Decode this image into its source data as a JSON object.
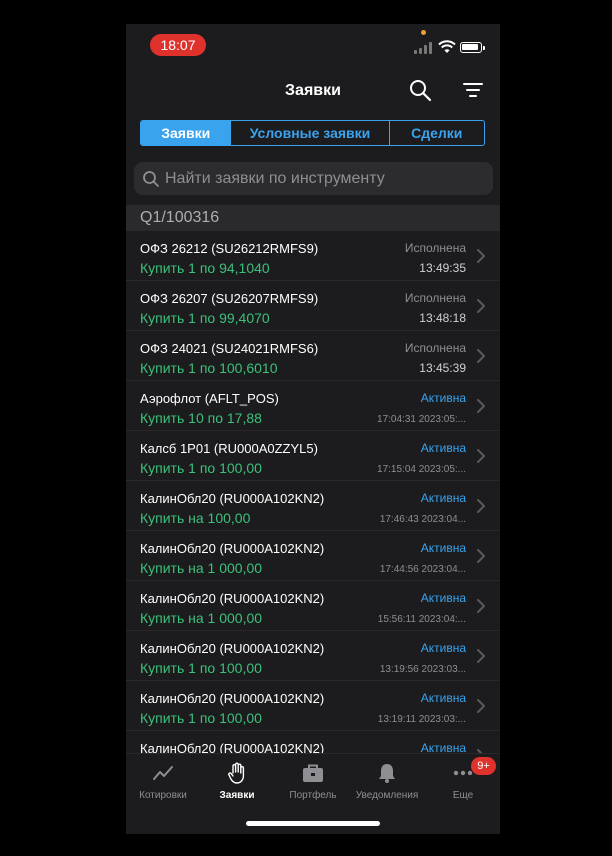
{
  "status_bar": {
    "time": "18:07"
  },
  "header": {
    "title": "Заявки"
  },
  "segments": [
    {
      "label": "Заявки",
      "active": true
    },
    {
      "label": "Условные заявки",
      "active": false
    },
    {
      "label": "Сделки",
      "active": false
    }
  ],
  "search": {
    "placeholder": "Найти заявки по инструменту"
  },
  "section": {
    "title": "Q1/100316"
  },
  "orders": [
    {
      "name": "ОФЗ 26212 (SU26212RMFS9)",
      "order": "Купить 1 по 94,1040",
      "status": "Исполнена",
      "status_type": "done",
      "time": "13:49:35"
    },
    {
      "name": "ОФЗ 26207 (SU26207RMFS9)",
      "order": "Купить 1 по 99,4070",
      "status": "Исполнена",
      "status_type": "done",
      "time": "13:48:18"
    },
    {
      "name": "ОФЗ 24021 (SU24021RMFS6)",
      "order": "Купить 1 по 100,6010",
      "status": "Исполнена",
      "status_type": "done",
      "time": "13:45:39"
    },
    {
      "name": "Аэрофлот (AFLT_POS)",
      "order": "Купить 10 по 17,88",
      "status": "Активна",
      "status_type": "active",
      "time": "17:04:31 2023:05:..."
    },
    {
      "name": "Калсб 1P01 (RU000A0ZZYL5)",
      "order": "Купить 1 по 100,00",
      "status": "Активна",
      "status_type": "active",
      "time": "17:15:04 2023:05:..."
    },
    {
      "name": "КалинОбл20 (RU000A102KN2)",
      "order": "Купить на 100,00",
      "status": "Активна",
      "status_type": "active",
      "time": "17:46:43 2023:04..."
    },
    {
      "name": "КалинОбл20 (RU000A102KN2)",
      "order": "Купить на 1 000,00",
      "status": "Активна",
      "status_type": "active",
      "time": "17:44:56 2023:04..."
    },
    {
      "name": "КалинОбл20 (RU000A102KN2)",
      "order": "Купить на 1 000,00",
      "status": "Активна",
      "status_type": "active",
      "time": "15:56:11 2023:04:..."
    },
    {
      "name": "КалинОбл20 (RU000A102KN2)",
      "order": "Купить 1 по 100,00",
      "status": "Активна",
      "status_type": "active",
      "time": "13:19:56 2023:03..."
    },
    {
      "name": "КалинОбл20 (RU000A102KN2)",
      "order": "Купить 1 по 100,00",
      "status": "Активна",
      "status_type": "active",
      "time": "13:19:11 2023:03:..."
    },
    {
      "name": "КалинОбл20 (RU000A102KN2)",
      "order": "",
      "status": "Активна",
      "status_type": "active",
      "time": ""
    }
  ],
  "tabs": [
    {
      "label": "Котировки",
      "icon": "chart-line-icon",
      "active": false
    },
    {
      "label": "Заявки",
      "icon": "hand-icon",
      "active": true
    },
    {
      "label": "Портфель",
      "icon": "briefcase-icon",
      "active": false
    },
    {
      "label": "Уведомления",
      "icon": "bell-icon",
      "active": false
    },
    {
      "label": "Еще",
      "icon": "more-dots-icon",
      "active": false
    }
  ],
  "more_badge": "9+",
  "colors": {
    "accent": "#3aa3ee",
    "buy": "#3cc07a",
    "badge": "#e0322d",
    "background": "#1c1c1e"
  }
}
